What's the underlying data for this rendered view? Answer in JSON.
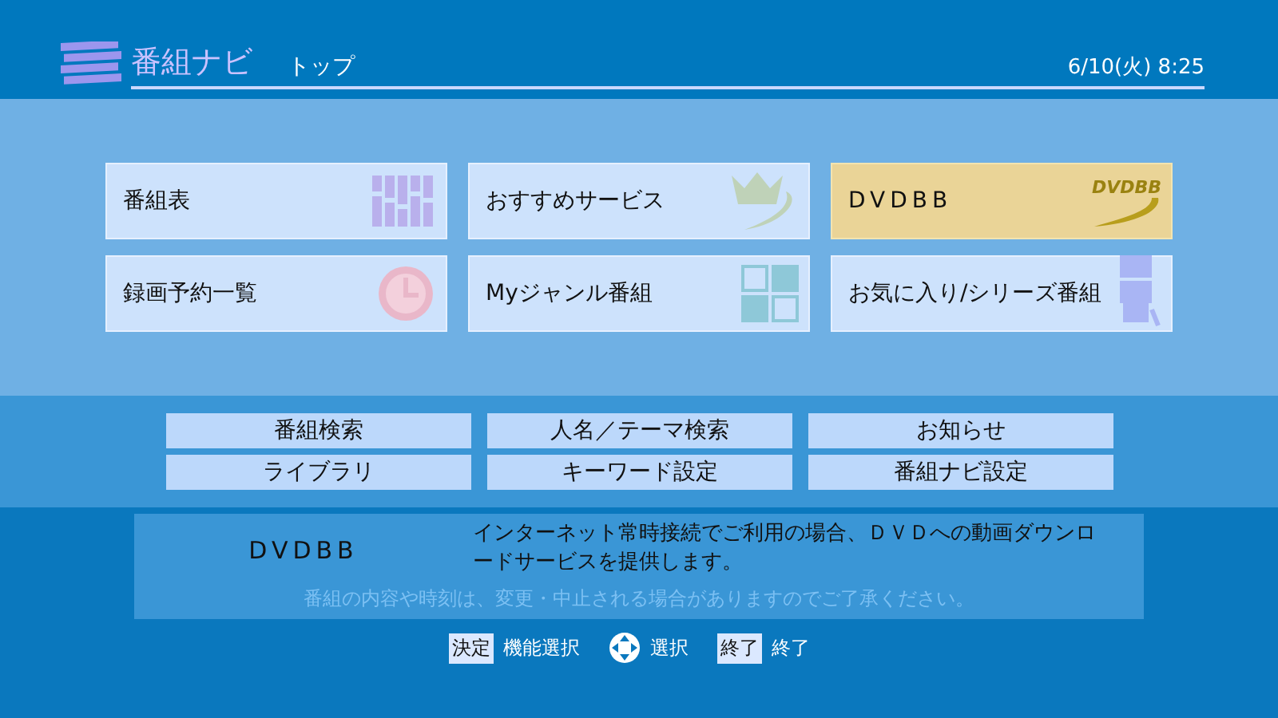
{
  "header": {
    "app_title": "番組ナビ",
    "page_title": "トップ",
    "datetime": "6/10(火) 8:25"
  },
  "tiles": [
    {
      "label": "番組表",
      "kind": "grid",
      "selected": false
    },
    {
      "label": "おすすめサービス",
      "kind": "crown",
      "selected": false
    },
    {
      "label": "DVDBB",
      "kind": "logo",
      "logo_text": "DVDBB",
      "selected": true
    },
    {
      "label": "録画予約一覧",
      "kind": "clock",
      "selected": false
    },
    {
      "label": "Myジャンル番組",
      "kind": "squares",
      "selected": false
    },
    {
      "label": "お気に入り/シリーズ番組",
      "kind": "robot",
      "selected": false
    }
  ],
  "sub_buttons": [
    "番組検索",
    "人名／テーマ検索",
    "お知らせ",
    "ライブラリ",
    "キーワード設定",
    "番組ナビ設定"
  ],
  "info": {
    "title": "DVDBB",
    "description": "インターネット常時接続でご利用の場合、ＤＶＤへの動画ダウンロードサービスを提供します。",
    "notice": "番組の内容や時刻は、変更・中止される場合がありますのでご了承ください。"
  },
  "legend": [
    {
      "kind": "key",
      "key": "決定",
      "label": "機能選択"
    },
    {
      "kind": "dpad",
      "label": "選択"
    },
    {
      "kind": "key",
      "key": "終了",
      "label": "終了"
    }
  ]
}
